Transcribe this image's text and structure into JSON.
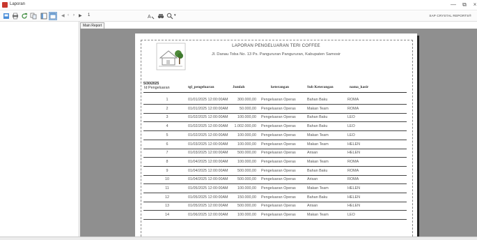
{
  "window": {
    "title": "Laporan"
  },
  "toolbar": {
    "page_number": "1",
    "brand": "SAP CRYSTAL REPORTS®"
  },
  "tabs": [
    {
      "label": "Main Report"
    }
  ],
  "report": {
    "title": "LAPORAN PENGELUARAN TERI COFFEE",
    "address": "Jl. Danau Toba No. 13 Ps. Pangururan Pangururan, Kabupaten Samosir",
    "print_date": "5/30/2025",
    "columns": [
      "Id Pengeluaran",
      "tgl_pengeluaran",
      "Jumlah",
      "keterangan",
      "Sub Keterangan",
      "nama_kasir"
    ],
    "rows": [
      {
        "id": "1",
        "tgl": "01/01/2025 12:00:00AM",
        "jumlah": "300.000,00",
        "ket": "Pengeluaran Operas",
        "sub": "Bahan Baku",
        "kasir": "ROMA"
      },
      {
        "id": "2",
        "tgl": "01/01/2025 12:00:00AM",
        "jumlah": "50.000,00",
        "ket": "Pengeluaran Operas",
        "sub": "Makan Team",
        "kasir": "ROMA"
      },
      {
        "id": "3",
        "tgl": "01/02/2025 12:00:00AM",
        "jumlah": "100.000,00",
        "ket": "Pengeluaran Operas",
        "sub": "Bahan Baku",
        "kasir": "LEO"
      },
      {
        "id": "4",
        "tgl": "01/02/2025 12:00:00AM",
        "jumlah": "1.002.000,00",
        "ket": "Pengeluaran Operas",
        "sub": "Bahan Baku",
        "kasir": "LEO"
      },
      {
        "id": "5",
        "tgl": "01/02/2025 12:00:00AM",
        "jumlah": "100.000,00",
        "ket": "Pengeluaran Operas",
        "sub": "Makan Team",
        "kasir": "LEO"
      },
      {
        "id": "6",
        "tgl": "01/03/2025 12:00:00AM",
        "jumlah": "100.000,00",
        "ket": "Pengeluaran Operas",
        "sub": "Makan Team",
        "kasir": "HELEN"
      },
      {
        "id": "7",
        "tgl": "01/03/2025 12:00:00AM",
        "jumlah": "500.000,00",
        "ket": "Pengeluaran Operas",
        "sub": "Arisan",
        "kasir": "HELEN"
      },
      {
        "id": "8",
        "tgl": "01/04/2025 12:00:00AM",
        "jumlah": "100.000,00",
        "ket": "Pengeluaran Operas",
        "sub": "Makan Team",
        "kasir": "ROMA"
      },
      {
        "id": "9",
        "tgl": "01/04/2025 12:00:00AM",
        "jumlah": "500.000,00",
        "ket": "Pengeluaran Operas",
        "sub": "Bahan Baku",
        "kasir": "ROMA"
      },
      {
        "id": "10",
        "tgl": "01/04/2025 12:00:00AM",
        "jumlah": "500.000,00",
        "ket": "Pengeluaran Operas",
        "sub": "Arisan",
        "kasir": "ROMA"
      },
      {
        "id": "11",
        "tgl": "01/05/2025 12:00:00AM",
        "jumlah": "100.000,00",
        "ket": "Pengeluaran Operas",
        "sub": "Makan Team",
        "kasir": "HELEN"
      },
      {
        "id": "12",
        "tgl": "01/05/2025 12:00:00AM",
        "jumlah": "150.000,00",
        "ket": "Pengeluaran Operas",
        "sub": "Bahan Baku",
        "kasir": "HELEN"
      },
      {
        "id": "13",
        "tgl": "01/05/2025 12:00:00AM",
        "jumlah": "500.000,00",
        "ket": "Pengeluaran Operas",
        "sub": "Arisan",
        "kasir": "HELEN"
      },
      {
        "id": "14",
        "tgl": "01/06/2025 12:00:00AM",
        "jumlah": "100.000,00",
        "ket": "Pengeluaran Operas",
        "sub": "Makan Team",
        "kasir": "LEO"
      }
    ]
  },
  "icons": {
    "toolbar": [
      "export-icon",
      "print-icon",
      "refresh-icon",
      "copy-icon",
      "toggle-group-tree-icon",
      "toggle-parameter-panel-icon",
      "first-page-icon",
      "previous-page-icon",
      "next-page-icon",
      "last-page-icon",
      "find-icon",
      "binoculars-icon",
      "zoom-icon"
    ]
  },
  "colors": {
    "viewer_background": "#8f8f8f",
    "selected_tool": "#cfe3f7"
  }
}
